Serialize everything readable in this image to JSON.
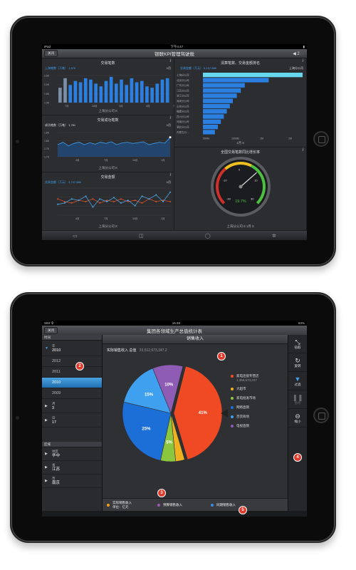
{
  "screen1": {
    "status": {
      "left": "iPad",
      "time": "下午4:47",
      "right": ""
    },
    "close_label": "关闭",
    "title": "银联KPI管理驾驶舱",
    "page": "2",
    "panel_a": {
      "title": "交易笔数",
      "legend": "上海笔数（万笔） 1,976",
      "period": "1月",
      "yticks": [
        "2.5K",
        "2.0K",
        "1.5K",
        "1.0K"
      ],
      "xticks": [
        "7月",
        "10月",
        "1月",
        "4月",
        "7月"
      ],
      "footer": "上海分公司 8",
      "bars": [
        0.55,
        0.9,
        0.65,
        0.8,
        0.75,
        0.9,
        0.85,
        0.7,
        0.6,
        0.8,
        0.95,
        0.7,
        0.85,
        0.65,
        0.9,
        0.75,
        0.8,
        0.6,
        0.55,
        0.7,
        0.85,
        0.9
      ]
    },
    "panel_b": {
      "title": "清算笔数、交易金额排名",
      "legend": "交易金额（万元） 6,157,886",
      "region": "上海分公司",
      "rows": [
        "上海分公司",
        "北京分公司",
        "广东分公司",
        "江苏分公司",
        "浙江分公司",
        "深圳分公司",
        "山东分公司",
        "福建分公司",
        "四川分公司",
        "河南分公司",
        "湖北分公司",
        "内蒙古分..."
      ],
      "values": [
        1.0,
        0.66,
        0.42,
        0.38,
        0.34,
        0.3,
        0.27,
        0.24,
        0.21,
        0.18,
        0.15,
        0.12
      ],
      "xticks": [
        "500M",
        "1000M",
        "1M",
        "1M"
      ],
      "footer": "1月 5"
    },
    "panel_c": {
      "title": "交易成功笔数",
      "label": "成功笔数（万笔） 1,781",
      "period": "1月",
      "yticks": [
        "1.85",
        "1.80",
        "1.75",
        "1.70"
      ],
      "xticks": [
        "4月",
        "7月",
        "10月",
        "1月"
      ],
      "footer": "上海分公司 8",
      "points": [
        0.5,
        0.6,
        0.45,
        0.55,
        0.6,
        0.5,
        0.58,
        0.52,
        0.6,
        0.55,
        0.62,
        0.5,
        0.57,
        0.6,
        0.55,
        0.58,
        0.62,
        0.5,
        0.55,
        0.6,
        0.56,
        0.8
      ]
    },
    "panel_d": {
      "title": "交易金额",
      "legend": "交易金额（万元） 3,747,886",
      "period": "1月",
      "xticks": [
        "4月",
        "7月",
        "10月",
        "1月"
      ],
      "footer": "上海分公司 8",
      "s1": [
        0.4,
        0.45,
        0.6,
        0.55,
        0.7,
        0.3,
        0.6,
        0.5,
        0.65,
        0.45,
        0.55,
        0.35,
        0.7,
        0.6,
        0.75,
        0.5,
        0.85
      ],
      "s2": [
        0.6,
        0.5,
        0.45,
        0.55,
        0.5,
        0.6,
        0.45,
        0.55,
        0.5,
        0.6,
        0.5,
        0.55,
        0.45,
        0.6,
        0.5,
        0.55,
        0.5
      ]
    },
    "panel_e": {
      "title": "全国交易笔数同比增长率",
      "value": "19.7%",
      "ticks": [
        "-30",
        "-10",
        "0",
        "10",
        "30"
      ],
      "footer": "上海分公司 8     1月 5"
    }
  },
  "screen2": {
    "status": {
      "left": "SIM 令",
      "time": "16:48",
      "right": "84%"
    },
    "close_label": "关闭",
    "title": "集团各领域生产总值统计表",
    "time_header": "时间",
    "year": {
      "label": "年",
      "value": "2010"
    },
    "years": [
      "2012",
      "2011",
      "2010",
      "2009"
    ],
    "selected_year": "2010",
    "month": {
      "label": "月",
      "value": "3"
    },
    "day": {
      "label": "日",
      "value": "17"
    },
    "region_header": "区域",
    "area": {
      "label": "地区",
      "value": "华中"
    },
    "province": {
      "label": "省",
      "value": "江苏"
    },
    "city": {
      "label": "市",
      "value": "南京"
    },
    "chart_title": "销售收入",
    "summary_label": "实际销售收入  总值",
    "summary_value": "23,512,673,347.2",
    "tools": [
      {
        "icon": "drill-icon",
        "label": "钻取"
      },
      {
        "icon": "rotate-icon",
        "label": "旋转"
      },
      {
        "icon": "filter-icon",
        "label": "过滤"
      },
      {
        "icon": "pause-icon",
        "label": "暂停"
      },
      {
        "icon": "zoom-out-icon",
        "label": "缩小"
      }
    ],
    "bottom_items": [
      {
        "label": "实际销售收入",
        "sub": "单位：亿元",
        "color": "#f0a020"
      },
      {
        "label": "预算销售收入",
        "color": "#9b59b6"
      },
      {
        "label": "同期销售收入",
        "color": "#3a8fe0"
      }
    ],
    "badges": [
      "1",
      "2",
      "3",
      "4",
      "5"
    ]
  },
  "chart_data": {
    "type": "pie",
    "title": "销售收入",
    "categories": [
      "家电连锁专营店",
      "大超市",
      "家电批发市场",
      "网络直销",
      "百货商场",
      "电视直销"
    ],
    "values": [
      41,
      3,
      5,
      25,
      15,
      10
    ],
    "slice_labels": [
      "41%",
      "",
      "5%",
      "25%",
      "15%",
      "10%"
    ],
    "colors": [
      "#f04a24",
      "#f0b020",
      "#8cc63f",
      "#1d6fd8",
      "#3fa0f0",
      "#8e5bb5"
    ],
    "annotation": {
      "category": "家电连锁专营店",
      "value": "1,365,573,347"
    }
  }
}
